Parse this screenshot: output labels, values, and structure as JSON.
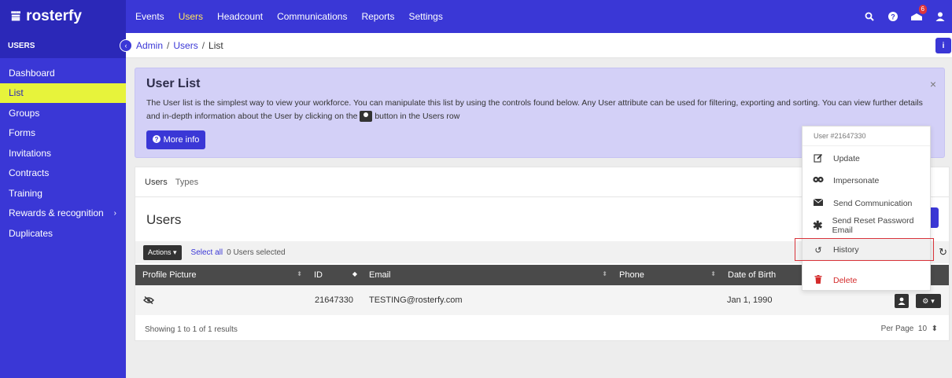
{
  "brand": {
    "name": "rosterfy",
    "color": "#3a37d6",
    "accent": "#e7f33b"
  },
  "topnav": {
    "items": [
      {
        "label": "Events",
        "active": false
      },
      {
        "label": "Users",
        "active": true
      },
      {
        "label": "Headcount",
        "active": false
      },
      {
        "label": "Communications",
        "active": false
      },
      {
        "label": "Reports",
        "active": false
      },
      {
        "label": "Settings",
        "active": false
      }
    ],
    "icons": [
      "search-icon",
      "help-icon",
      "notifications-icon",
      "user-icon"
    ],
    "notification_count": "6"
  },
  "sidebar": {
    "title": "USERS",
    "items": [
      {
        "label": "Dashboard",
        "active": false
      },
      {
        "label": "List",
        "active": true
      },
      {
        "label": "Groups",
        "active": false
      },
      {
        "label": "Forms",
        "active": false
      },
      {
        "label": "Invitations",
        "active": false
      },
      {
        "label": "Contracts",
        "active": false
      },
      {
        "label": "Training",
        "active": false
      },
      {
        "label": "Rewards & recognition",
        "active": false,
        "has_submenu": true
      },
      {
        "label": "Duplicates",
        "active": false
      }
    ]
  },
  "breadcrumb": {
    "items": [
      "Admin",
      "Users",
      "List"
    ]
  },
  "banner": {
    "title": "User List",
    "text_before": "The User list is the simplest way to view your workforce. You can manipulate this list by using the controls found below. Any User attribute can be used for filtering, exporting and sorting. You can view further details and in-depth information about the User by clicking on the",
    "text_after": "button in the Users row",
    "more_info_label": "More info",
    "close_label": "×"
  },
  "card": {
    "tabs": [
      "Users",
      "Types"
    ],
    "title": "Users",
    "actions_label": "Actions",
    "select_all_label": "Select all",
    "selected_text": "0 Users selected",
    "columns": [
      "Profile Picture",
      "ID",
      "Email",
      "Phone",
      "Date of Birth"
    ],
    "rows": [
      {
        "id": "21647330",
        "email": "TESTING@rosterfy.com",
        "phone": "",
        "dob": "Jan 1, 1990"
      }
    ],
    "footer_text": "Showing 1 to 1 of 1 results",
    "per_page_label": "Per Page",
    "per_page_value": "10"
  },
  "row_menu": {
    "header": "User #21647330",
    "items": [
      {
        "label": "Update",
        "icon": "edit-icon"
      },
      {
        "label": "Impersonate",
        "icon": "mask-icon"
      },
      {
        "label": "Send Communication",
        "icon": "envelope-icon"
      },
      {
        "label": "Send Reset Password Email",
        "icon": "asterisk-icon"
      },
      {
        "label": "History",
        "icon": "history-icon",
        "highlighted": true
      },
      {
        "label": "Delete",
        "icon": "trash-icon",
        "danger": true
      }
    ]
  }
}
